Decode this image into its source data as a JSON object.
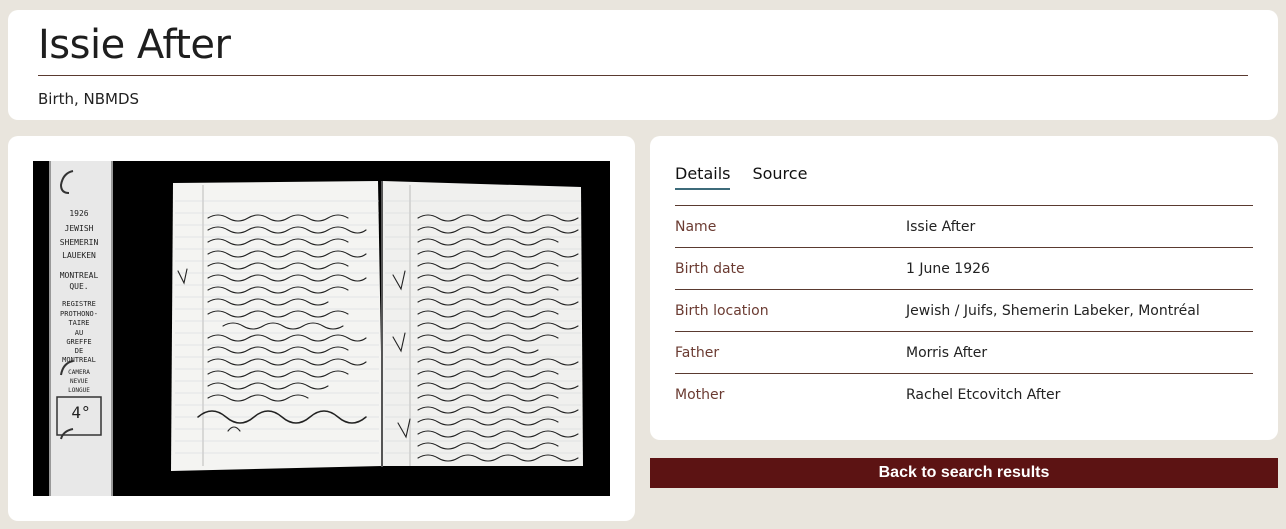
{
  "header": {
    "title": "Issie After",
    "subtitle": "Birth, NBMDS"
  },
  "tabs": [
    {
      "label": "Details",
      "active": true
    },
    {
      "label": "Source",
      "active": false
    }
  ],
  "details": [
    {
      "label": "Name",
      "value": "Issie After"
    },
    {
      "label": "Birth date",
      "value": "1 June 1926"
    },
    {
      "label": "Birth location",
      "value": "Jewish / Juifs, Shemerin Labeker, Montréal"
    },
    {
      "label": "Father",
      "value": "Morris After"
    },
    {
      "label": "Mother",
      "value": "Rachel Etcovitch After"
    }
  ],
  "record_image": {
    "strip_labels": [
      "1926",
      "JEWISH",
      "SHEMERIN",
      "LAUEKEN",
      "MONTREAL",
      "QUE.",
      "REGISTRE",
      "PROTHONO-",
      "TAIRE",
      "AU",
      "GREFFE",
      "DE",
      "MONTREAL",
      "CAMERA",
      "NEVUE",
      "LONGUE",
      "4°"
    ]
  },
  "actions": {
    "back_label": "Back to search results"
  },
  "colors": {
    "background": "#e9e5dd",
    "label": "#6b3b32",
    "rule": "#5a3a30",
    "button": "#5c1313",
    "tab_underline": "#3d6b7a"
  }
}
